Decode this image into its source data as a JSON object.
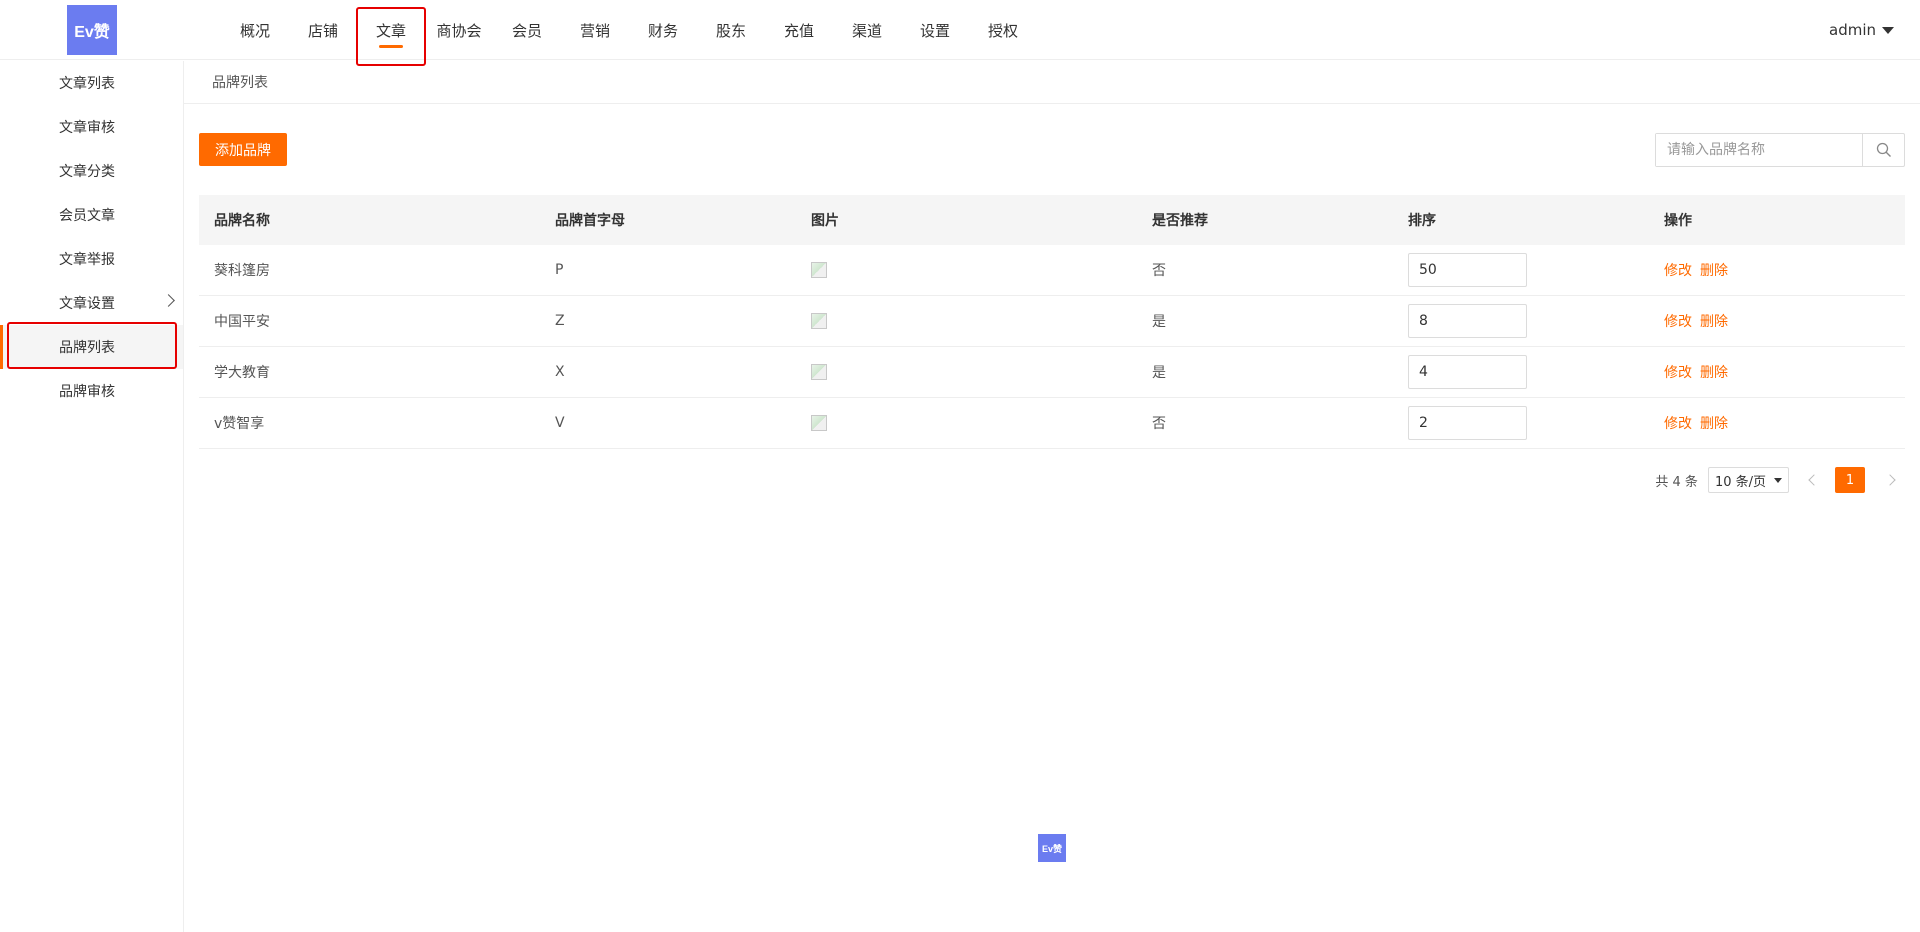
{
  "header": {
    "logo_text": "Ev赞",
    "nav": [
      "概况",
      "店铺",
      "文章",
      "商协会",
      "会员",
      "营销",
      "财务",
      "股东",
      "充值",
      "渠道",
      "设置",
      "授权"
    ],
    "active_nav": "文章",
    "user": "admin"
  },
  "sidebar": {
    "items": [
      {
        "label": "文章列表"
      },
      {
        "label": "文章审核"
      },
      {
        "label": "文章分类"
      },
      {
        "label": "会员文章"
      },
      {
        "label": "文章举报"
      },
      {
        "label": "文章设置"
      },
      {
        "label": "品牌列表"
      },
      {
        "label": "品牌审核"
      }
    ],
    "active_item": "品牌列表"
  },
  "breadcrumb": "品牌列表",
  "toolbar": {
    "add_label": "添加品牌",
    "search_placeholder": "请输入品牌名称"
  },
  "table": {
    "headers": [
      "品牌名称",
      "品牌首字母",
      "图片",
      "是否推荐",
      "排序",
      "操作"
    ],
    "rows": [
      {
        "name": "葵科篷房",
        "letter": "P",
        "recommend": "否",
        "sort": "50"
      },
      {
        "name": "中国平安",
        "letter": "Z",
        "recommend": "是",
        "sort": "8"
      },
      {
        "name": "学大教育",
        "letter": "X",
        "recommend": "是",
        "sort": "4"
      },
      {
        "name": "v赞智享",
        "letter": "V",
        "recommend": "否",
        "sort": "2"
      }
    ],
    "edit_label": "修改",
    "delete_label": "删除"
  },
  "pagination": {
    "total": "共 4 条",
    "page_size": "10 条/页",
    "current_page": "1"
  },
  "footer": {
    "logo_text": "Ev赞"
  },
  "colors": {
    "accent": "#ff6a00",
    "brand": "#6b7cf0",
    "highlight": "#e60000"
  }
}
